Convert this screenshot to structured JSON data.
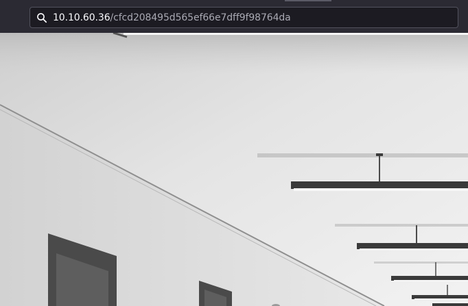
{
  "address_bar": {
    "host": "10.10.60.36",
    "path": "/cfcd208495d565ef66e7dff9f98764da",
    "icon": "search-icon"
  },
  "page": {
    "image": "grayscale-corridor-ceiling-lights-photo"
  },
  "colors": {
    "toolbar_bg": "#2b2a33",
    "urlbar_bg": "#1c1b22",
    "url_host": "#fbfbfe",
    "url_path": "#a9a9b3"
  }
}
